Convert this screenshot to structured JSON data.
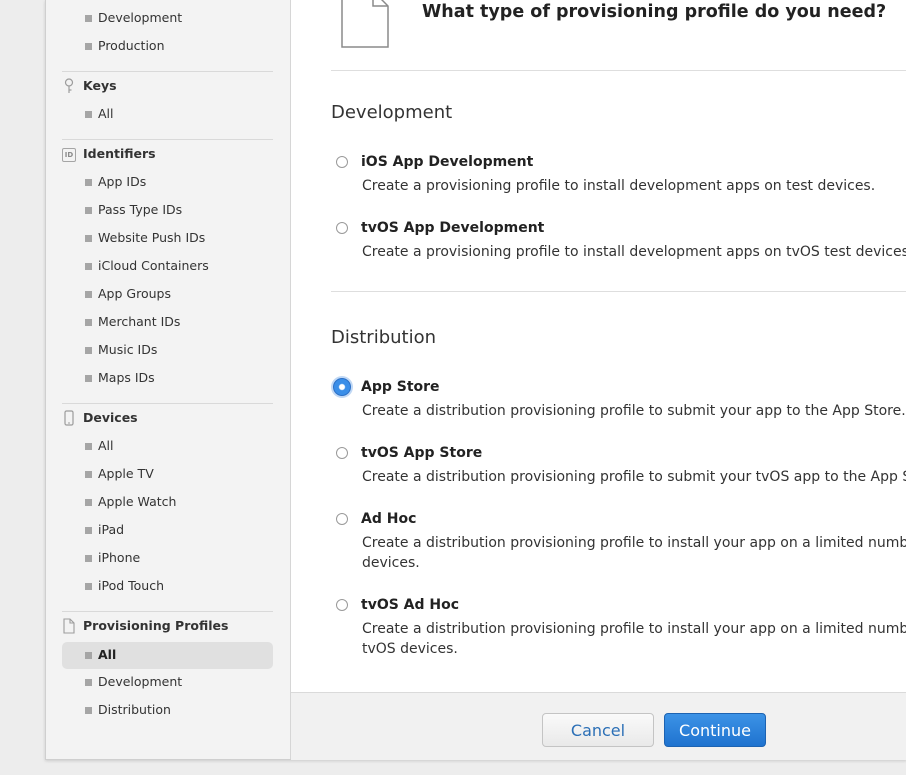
{
  "sidebar": {
    "certs_items": [
      "Development",
      "Production"
    ],
    "keys": {
      "title": "Keys",
      "items": [
        "All"
      ]
    },
    "identifiers": {
      "title": "Identifiers",
      "icon_text": "ID",
      "items": [
        "App IDs",
        "Pass Type IDs",
        "Website Push IDs",
        "iCloud Containers",
        "App Groups",
        "Merchant IDs",
        "Music IDs",
        "Maps IDs"
      ]
    },
    "devices": {
      "title": "Devices",
      "items": [
        "All",
        "Apple TV",
        "Apple Watch",
        "iPad",
        "iPhone",
        "iPod Touch"
      ]
    },
    "profiles": {
      "title": "Provisioning Profiles",
      "items": [
        "All",
        "Development",
        "Distribution"
      ],
      "active_item": "All"
    }
  },
  "main": {
    "title": "What type of provisioning profile do you need?",
    "development": {
      "title": "Development",
      "options": [
        {
          "title": "iOS App Development",
          "desc": "Create a provisioning profile to install development apps on test devices.",
          "selected": false
        },
        {
          "title": "tvOS App Development",
          "desc": "Create a provisioning profile to install development apps on tvOS test devices.",
          "selected": false
        }
      ]
    },
    "distribution": {
      "title": "Distribution",
      "options": [
        {
          "title": "App Store",
          "desc": "Create a distribution provisioning profile to submit your app to the App Store.",
          "selected": true
        },
        {
          "title": "tvOS App Store",
          "desc": "Create a distribution provisioning profile to submit your tvOS app to the App Store",
          "selected": false
        },
        {
          "title": "Ad Hoc",
          "desc": "Create a distribution provisioning profile to install your app on a limited number of devices.",
          "selected": false
        },
        {
          "title": "tvOS Ad Hoc",
          "desc": "Create a distribution provisioning profile to install your app on a limited number of tvOS devices.",
          "selected": false
        }
      ]
    }
  },
  "footer": {
    "cancel_label": "Cancel",
    "continue_label": "Continue"
  },
  "colors": {
    "accent": "#1f73cf",
    "cancel_text": "#2b6fb6",
    "sidebar_bg": "#f3f3f3"
  }
}
